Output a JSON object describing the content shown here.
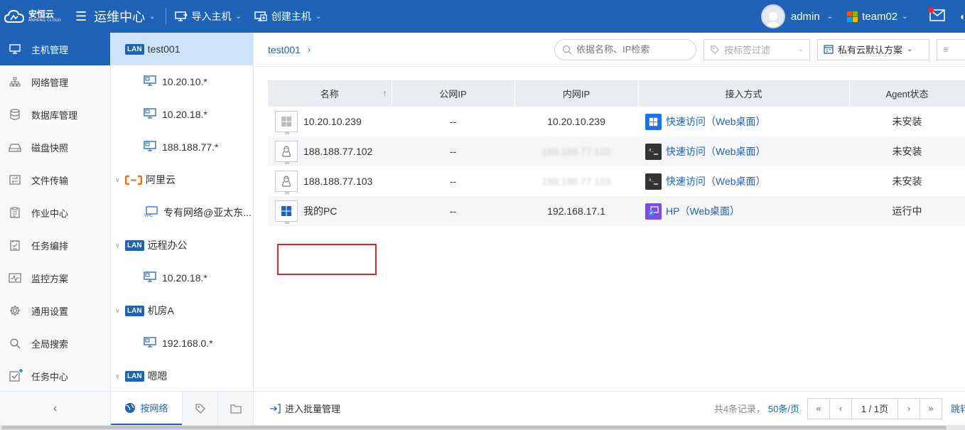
{
  "brand": {
    "name": "安恒云",
    "sub": "ANHENG CLOUD"
  },
  "header": {
    "app_title": "运维中心",
    "menus": [
      {
        "label": "导入主机",
        "icon": "import-host-icon"
      },
      {
        "label": "创建主机",
        "icon": "create-host-icon"
      }
    ],
    "user": "admin",
    "team": "team02"
  },
  "sidenav": {
    "items": [
      {
        "label": "主机管理",
        "icon": "monitor-icon",
        "active": true
      },
      {
        "label": "网络管理",
        "icon": "network-icon"
      },
      {
        "label": "数据库管理",
        "icon": "database-icon"
      },
      {
        "label": "磁盘快照",
        "icon": "disk-icon"
      },
      {
        "label": "文件传输",
        "icon": "file-transfer-icon"
      },
      {
        "label": "作业中心",
        "icon": "clipboard-icon"
      },
      {
        "label": "任务编排",
        "icon": "task-icon"
      },
      {
        "label": "监控方案",
        "icon": "pulse-icon"
      },
      {
        "label": "通用设置",
        "icon": "gear-icon"
      },
      {
        "label": "全局搜索",
        "icon": "search-icon"
      },
      {
        "label": "任务中心",
        "icon": "task-center-icon",
        "dot": true
      }
    ]
  },
  "tree": {
    "nodes": [
      {
        "type": "LAN",
        "label": "test001",
        "level": 0,
        "selected": true
      },
      {
        "type": "net",
        "label": "10.20.10.*",
        "level": 1
      },
      {
        "type": "net",
        "label": "10.20.18.*",
        "level": 1
      },
      {
        "type": "net",
        "label": "188.188.77.*",
        "level": 1
      },
      {
        "type": "ali",
        "label": "阿里云",
        "level": 0
      },
      {
        "type": "vpc",
        "label": "专有网络@亚太东...",
        "level": 1
      },
      {
        "type": "LAN",
        "label": "远程办公",
        "level": 0
      },
      {
        "type": "net",
        "label": "10.20.18.*",
        "level": 1
      },
      {
        "type": "LAN",
        "label": "机房A",
        "level": 0
      },
      {
        "type": "net",
        "label": "192.168.0.*",
        "level": 1
      },
      {
        "type": "LAN",
        "label": "嗯嗯",
        "level": 0
      }
    ],
    "lan_badge": "LAN",
    "tab_network": "按网络"
  },
  "main": {
    "breadcrumb": "test001",
    "search_placeholder": "依据名称、IP检索",
    "tag_filter": "按标签过滤",
    "plan": "私有云默认方案",
    "columns": [
      "名称",
      "公网IP",
      "内网IP",
      "接入方式",
      "Agent状态"
    ],
    "rows": [
      {
        "os": "windows",
        "name": "10.20.10.239",
        "public_ip": "--",
        "private_ip": "10.20.10.239",
        "access_type": "windows",
        "access": "快速访问（Web桌面）",
        "status": "未安装"
      },
      {
        "os": "linux",
        "name": "188.188.77.102",
        "public_ip": "--",
        "private_ip": "188.188.77.102",
        "private_blur": true,
        "access_type": "terminal",
        "access": "快速访问（Web桌面）",
        "status": "未安装"
      },
      {
        "os": "linux",
        "name": "188.188.77.103",
        "public_ip": "--",
        "private_ip": "188.188.77.103",
        "private_blur": true,
        "access_type": "terminal",
        "access": "快速访问（Web桌面）",
        "status": "未安装"
      },
      {
        "os": "windows",
        "name": "我的PC",
        "public_ip": "--",
        "private_ip": "192.168.17.1",
        "access_type": "remote",
        "access": "HP（Web桌面）",
        "status": "运行中"
      }
    ]
  },
  "footer": {
    "batch": "进入批量管理",
    "count": "共4条记录，",
    "page_size": "50条/页",
    "page_info": "1 / 1页",
    "jump": "跳转"
  },
  "colors": {
    "primary": "#1f63b8",
    "highlight": "#d9282c"
  }
}
